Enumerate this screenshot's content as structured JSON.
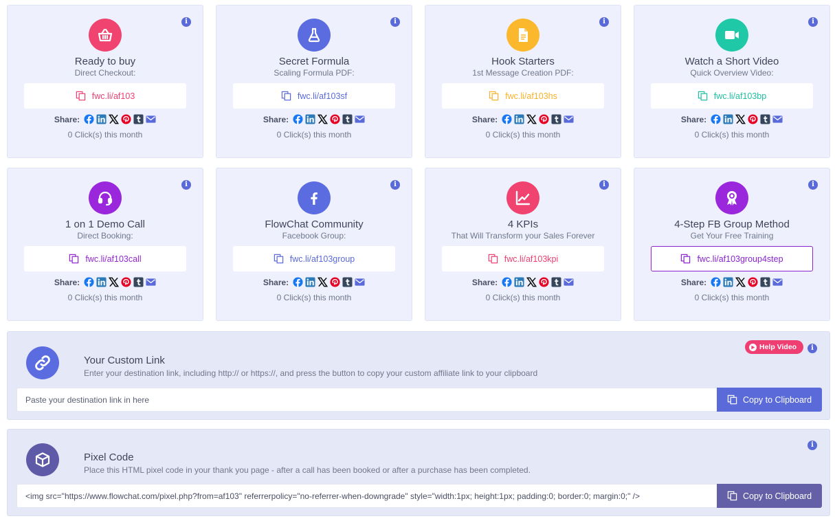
{
  "colors": {
    "card_bg": "#eef1fd",
    "panel_bg": "#e5e8f7",
    "accent": "#5a6ad9",
    "facebook": "#1877f2",
    "linkedin": "#2c7ab8",
    "pinterest": "#e60023",
    "tumblr": "#36465d",
    "email": "#5a6ad9",
    "x": "#111111"
  },
  "share_label": "Share:",
  "info_glyph": "i",
  "cards": [
    {
      "title": "Ready to buy",
      "subtitle": "Direct Checkout:",
      "link": "fwc.li/af103",
      "clicks": "0 Click(s) this month",
      "icon": "basket-icon",
      "icon_bg": "#f0436f",
      "link_color": "#ef3f72"
    },
    {
      "title": "Secret Formula",
      "subtitle": "Scaling Formula PDF:",
      "link": "fwc.li/af103sf",
      "clicks": "0 Click(s) this month",
      "icon": "flask-icon",
      "icon_bg": "#5b6ce0",
      "link_color": "#5a6ad9"
    },
    {
      "title": "Hook Starters",
      "subtitle": "1st Message Creation PDF:",
      "link": "fwc.li/af103hs",
      "clicks": "0 Click(s) this month",
      "icon": "document-icon",
      "icon_bg": "#fbb82c",
      "link_color": "#f7b22b"
    },
    {
      "title": "Watch a Short Video",
      "subtitle": "Quick Overview Video:",
      "link": "fwc.li/af103bp",
      "clicks": "0 Click(s) this month",
      "icon": "video-camera-icon",
      "icon_bg": "#1fc9a8",
      "link_color": "#1fbfa0"
    },
    {
      "title": "1 on 1 Demo Call",
      "subtitle": "Direct Booking:",
      "link": "fwc.li/af103call",
      "clicks": "0 Click(s) this month",
      "icon": "headset-icon",
      "icon_bg": "#9b27dd",
      "link_color": "#9427d3"
    },
    {
      "title": "FlowChat Community",
      "subtitle": "Facebook Group:",
      "link": "fwc.li/af103group",
      "clicks": "0 Click(s) this month",
      "icon": "facebook-icon",
      "icon_bg": "#5b6ce0",
      "link_color": "#5a6ad9"
    },
    {
      "title": "4 KPIs",
      "subtitle": "That Will Transform your Sales Forever",
      "link": "fwc.li/af103kpi",
      "clicks": "0 Click(s) this month",
      "icon": "line-chart-icon",
      "icon_bg": "#f0436f",
      "link_color": "#ef3f72"
    },
    {
      "title": "4-Step FB Group Method",
      "subtitle": "Get Your Free Training",
      "link": "fwc.li/af103group4step",
      "clicks": "0 Click(s) this month",
      "icon": "award-ribbon-icon",
      "icon_bg": "#9b27dd",
      "link_color": "#8a24d0"
    }
  ],
  "custom_link": {
    "title": "Your Custom Link",
    "description": "Enter your destination link, including http:// or https://, and press the button to copy your custom affiliate link to your clipboard",
    "placeholder": "Paste your destination link in here",
    "button_label": "Copy to Clipboard",
    "help_video_label": "Help Video",
    "icon_bg": "#5b6ce0",
    "button_bg": "#5a6ad9"
  },
  "pixel_code": {
    "title": "Pixel Code",
    "description": "Place this HTML pixel code in your thank you page - after a call has been booked or after a purchase has been completed.",
    "code": "<img src=\"https://www.flowchat.com/pixel.php?from=af103\" referrerpolicy=\"no-referrer-when-downgrade\" style=\"width:1px; height:1px; padding:0; border:0; margin:0;\" />",
    "button_label": "Copy to Clipboard",
    "icon_bg": "#5e5aa8",
    "button_bg": "#6360a8"
  }
}
